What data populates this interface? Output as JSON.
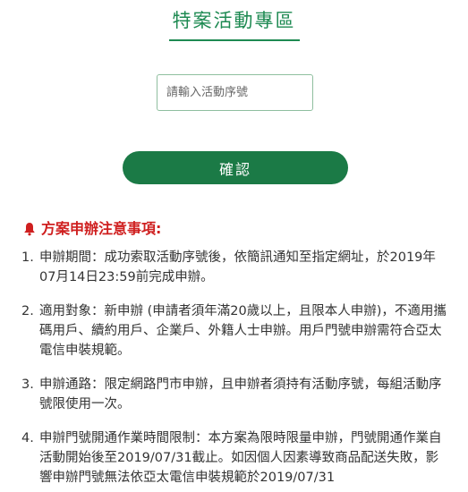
{
  "header": {
    "title": "特案活動專區"
  },
  "form": {
    "input_placeholder": "請輸入活動序號",
    "input_value": "",
    "confirm_label": "確認"
  },
  "notice": {
    "heading": "方案申辦注意事項:",
    "accent_color": "#cf1f1f",
    "icon": "bell-icon",
    "items": [
      {
        "num": "1.",
        "text": "申辦期間：成功索取活動序號後，依簡訊通知至指定網址，於2019年07月14日23:59前完成申辦。"
      },
      {
        "num": "2.",
        "text": "適用對象：新申辦 (申請者須年滿20歲以上，且限本人申辦)，不適用攜碼用戶、續約用戶、企業戶、外籍人士申辦。用戶門號申辦需符合亞太電信申裝規範。"
      },
      {
        "num": "3.",
        "text": "申辦通路：限定網路門市申辦，且申辦者須持有活動序號，每組活動序號限使用一次。"
      },
      {
        "num": "4.",
        "text": "申辦門號開通作業時間限制：本方案為限時限量申辦，門號開通作業自活動開始後至2019/07/31截止。如因個人因素導致商品配送失敗，影響申辦門號無法依亞太電信申裝規範於2019/07/31"
      }
    ]
  },
  "colors": {
    "brand_green": "#1e8a52",
    "button_green": "#1b7a46"
  }
}
